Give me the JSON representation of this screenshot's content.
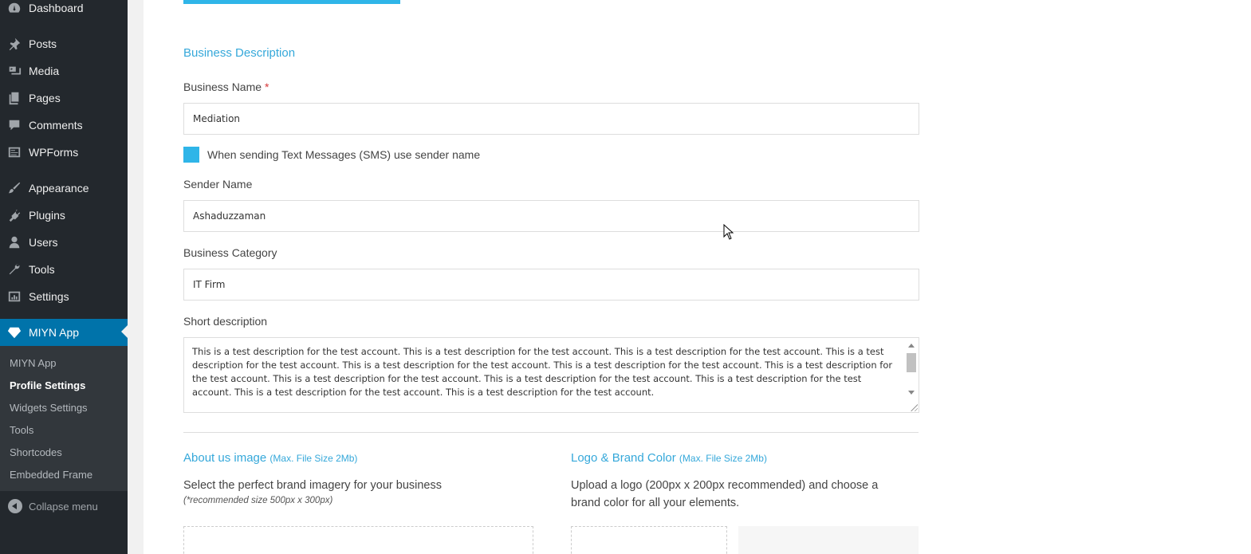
{
  "sidebar": {
    "menu": [
      {
        "label": "Dashboard",
        "icon": "dashboard-icon"
      },
      {
        "label": "Posts",
        "icon": "pin-icon"
      },
      {
        "label": "Media",
        "icon": "media-icon"
      },
      {
        "label": "Pages",
        "icon": "pages-icon"
      },
      {
        "label": "Comments",
        "icon": "comment-icon"
      },
      {
        "label": "WPForms",
        "icon": "forms-icon"
      },
      {
        "label": "Appearance",
        "icon": "brush-icon"
      },
      {
        "label": "Plugins",
        "icon": "plugin-icon"
      },
      {
        "label": "Users",
        "icon": "user-icon"
      },
      {
        "label": "Tools",
        "icon": "wrench-icon"
      },
      {
        "label": "Settings",
        "icon": "settings-icon"
      },
      {
        "label": "MIYN App",
        "icon": "diamond-icon"
      }
    ],
    "submenu": [
      "MIYN App",
      "Profile Settings",
      "Widgets Settings",
      "Tools",
      "Shortcodes",
      "Embedded Frame"
    ],
    "collapse_label": "Collapse menu"
  },
  "form": {
    "section_title": "Business Description",
    "business_name": {
      "label": "Business Name",
      "required_mark": "*",
      "value": "Mediation"
    },
    "sms_checkbox_label": "When sending Text Messages (SMS) use sender name",
    "sender_name": {
      "label": "Sender Name",
      "value": "Ashaduzzaman"
    },
    "business_category": {
      "label": "Business Category",
      "value": "IT Firm"
    },
    "short_description": {
      "label": "Short description",
      "value": "This is a test description for the test account. This is a test description for the test account. This is a test description for the test account. This is a test description for the test account. This is a test description for the test account. This is a test description for the test account. This is a test description for the test account. This is a test description for the test account. This is a test description for the test account. This is a test description for the test account. This is a test description for the test account. This is a test description for the test account."
    }
  },
  "about_image": {
    "title": "About us image",
    "hint": "(Max. File Size 2Mb)",
    "description": "Select the perfect brand imagery for your business",
    "note": "(*recommended size 500px x 300px)"
  },
  "logo": {
    "title": "Logo & Brand Color",
    "hint": "(Max. File Size 2Mb)",
    "description": "Upload a logo (200px x 200px recommended) and choose a brand color for all your elements."
  },
  "colors": {
    "accent": "#2fb5e8",
    "sidebar": "#23282d",
    "active": "#0073aa"
  }
}
